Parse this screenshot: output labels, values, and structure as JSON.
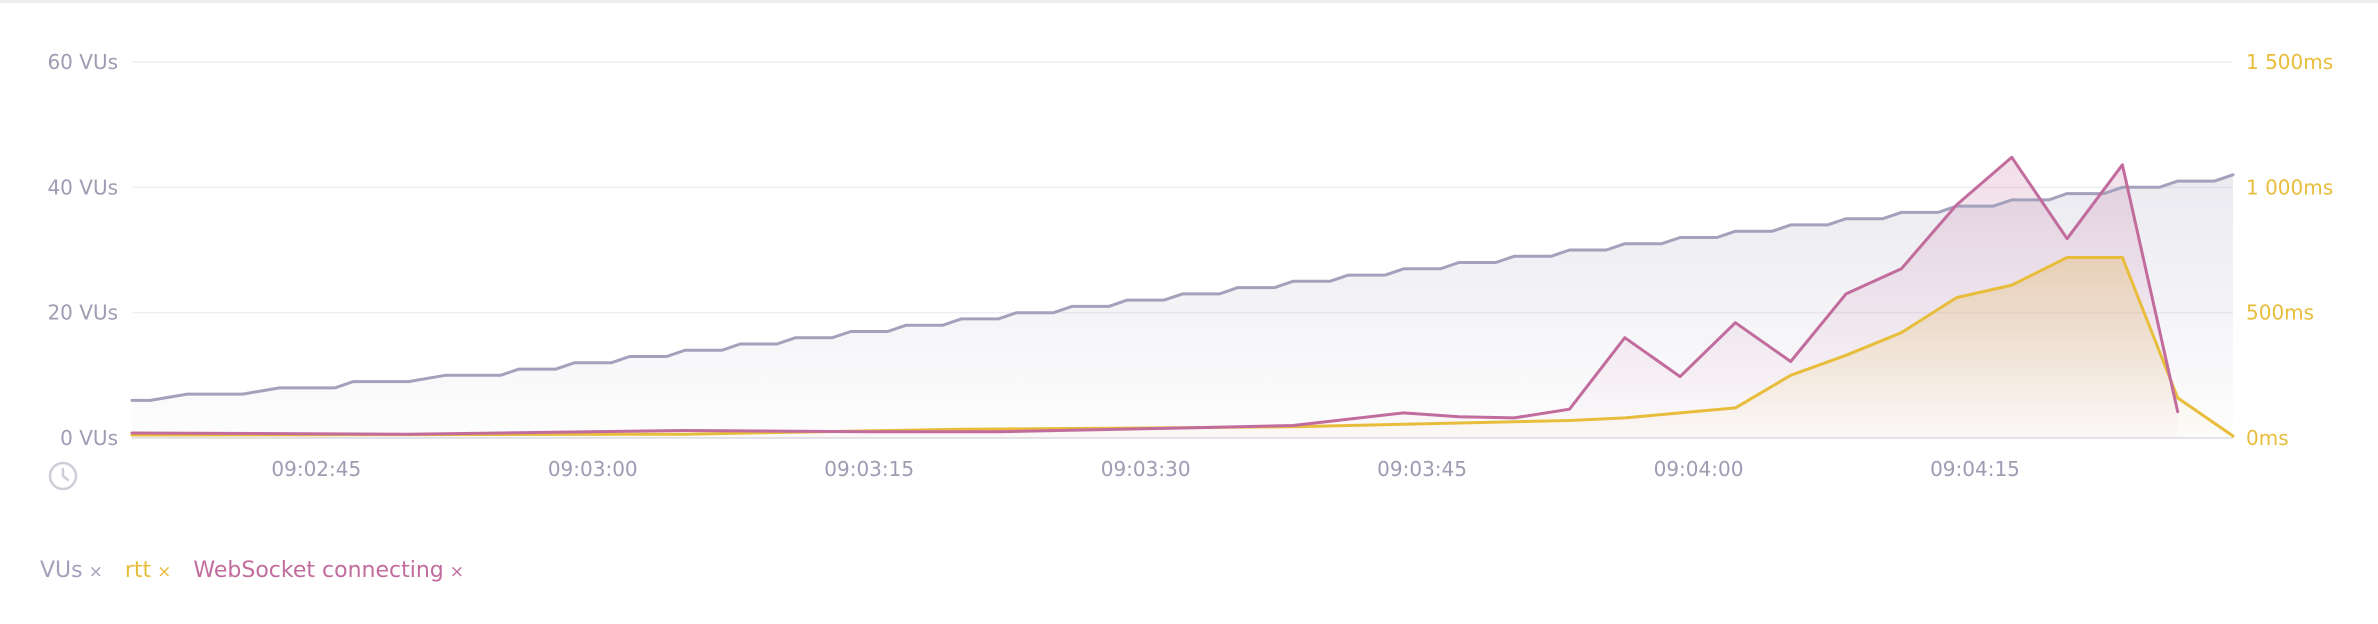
{
  "chart_data": {
    "type": "line",
    "title": "",
    "x_ticks": [
      "09:02:45",
      "09:03:00",
      "09:03:15",
      "09:03:30",
      "09:03:45",
      "09:04:00",
      "09:04:15"
    ],
    "xlim": [
      "09:02:35",
      "09:04:29"
    ],
    "y_left": {
      "ticks": [
        "0 VUs",
        "20 VUs",
        "40 VUs",
        "60 VUs"
      ],
      "ylim": [
        0,
        60
      ],
      "unit": "VUs"
    },
    "y_right": {
      "ticks": [
        "0ms",
        "500ms",
        "1 000ms",
        "1 500ms"
      ],
      "ylim": [
        0,
        1500
      ],
      "unit": "ms"
    },
    "grid": true,
    "legend_position": "bottom-left",
    "series": [
      {
        "name": "VUs",
        "axis": "left",
        "color": "#a3a1bb",
        "x": [
          "09:02:35",
          "09:02:36",
          "09:02:38",
          "09:02:40",
          "09:02:41",
          "09:02:43",
          "09:02:44",
          "09:02:46",
          "09:02:47",
          "09:02:49",
          "09:02:50",
          "09:02:52",
          "09:02:53",
          "09:02:55",
          "09:02:56",
          "09:02:58",
          "09:02:59",
          "09:03:01",
          "09:03:02",
          "09:03:04",
          "09:03:05",
          "09:03:07",
          "09:03:08",
          "09:03:10",
          "09:03:11",
          "09:03:13",
          "09:03:14",
          "09:03:16",
          "09:03:17",
          "09:03:19",
          "09:03:20",
          "09:03:22",
          "09:03:23",
          "09:03:25",
          "09:03:26",
          "09:03:28",
          "09:03:29",
          "09:03:31",
          "09:03:32",
          "09:03:34",
          "09:03:35",
          "09:03:37",
          "09:03:38",
          "09:03:40",
          "09:03:41",
          "09:03:43",
          "09:03:44",
          "09:03:46",
          "09:03:47",
          "09:03:49",
          "09:03:50",
          "09:03:52",
          "09:03:53",
          "09:03:55",
          "09:03:56",
          "09:03:58",
          "09:03:59",
          "09:04:01",
          "09:04:02",
          "09:04:04",
          "09:04:05",
          "09:04:07",
          "09:04:08",
          "09:04:10",
          "09:04:11",
          "09:04:13",
          "09:04:14",
          "09:04:16",
          "09:04:17",
          "09:04:19",
          "09:04:20",
          "09:04:22",
          "09:04:23",
          "09:04:25",
          "09:04:26",
          "09:04:28",
          "09:04:29"
        ],
        "values": [
          6,
          6,
          7,
          7,
          7,
          8,
          8,
          8,
          9,
          9,
          9,
          10,
          10,
          10,
          11,
          11,
          12,
          12,
          13,
          13,
          14,
          14,
          15,
          15,
          16,
          16,
          17,
          17,
          18,
          18,
          19,
          19,
          20,
          20,
          21,
          21,
          22,
          22,
          23,
          23,
          24,
          24,
          25,
          25,
          26,
          26,
          27,
          27,
          28,
          28,
          29,
          29,
          30,
          30,
          31,
          31,
          32,
          32,
          33,
          33,
          34,
          34,
          35,
          35,
          36,
          36,
          37,
          37,
          38,
          38,
          39,
          39,
          40,
          40,
          41,
          41,
          42
        ]
      },
      {
        "name": "rtt",
        "axis": "right",
        "color": "#e8bd3c",
        "x": [
          "09:02:35",
          "09:03:05",
          "09:03:20",
          "09:03:30",
          "09:03:38",
          "09:03:47",
          "09:03:53",
          "09:03:56",
          "09:03:59",
          "09:04:02",
          "09:04:05",
          "09:04:08",
          "09:04:11",
          "09:04:14",
          "09:04:17",
          "09:04:20",
          "09:04:23",
          "09:04:26",
          "09:04:29"
        ],
        "values": [
          12,
          15,
          35,
          40,
          45,
          60,
          70,
          80,
          100,
          120,
          250,
          330,
          420,
          560,
          610,
          720,
          720,
          160,
          8
        ]
      },
      {
        "name": "WebSocket connecting",
        "axis": "right",
        "color": "#c26c9e",
        "x": [
          "09:02:35",
          "09:02:50",
          "09:03:05",
          "09:03:15",
          "09:03:22",
          "09:03:32",
          "09:03:38",
          "09:03:44",
          "09:03:47",
          "09:03:50",
          "09:03:53",
          "09:03:56",
          "09:03:59",
          "09:04:02",
          "09:04:05",
          "09:04:08",
          "09:04:11",
          "09:04:14",
          "09:04:17",
          "09:04:20",
          "09:04:23",
          "09:04:26"
        ],
        "values": [
          20,
          15,
          30,
          25,
          25,
          40,
          50,
          100,
          85,
          80,
          115,
          400,
          245,
          460,
          305,
          575,
          675,
          930,
          1120,
          795,
          1090,
          105
        ]
      }
    ]
  },
  "legend": [
    {
      "label": "VUs",
      "close": "×",
      "color": "#a3a1bb"
    },
    {
      "label": "rtt",
      "close": "×",
      "color": "#e8bd3c"
    },
    {
      "label": "WebSocket connecting",
      "close": "×",
      "color": "#c26c9e"
    }
  ],
  "colors": {
    "grid": "#efeef2",
    "axis_text": "#9d9cb2",
    "right_axis_text": "#e8bd3c",
    "clock_icon": "#cfcdd8"
  },
  "icons": {
    "reset_zoom": "clock-icon"
  }
}
